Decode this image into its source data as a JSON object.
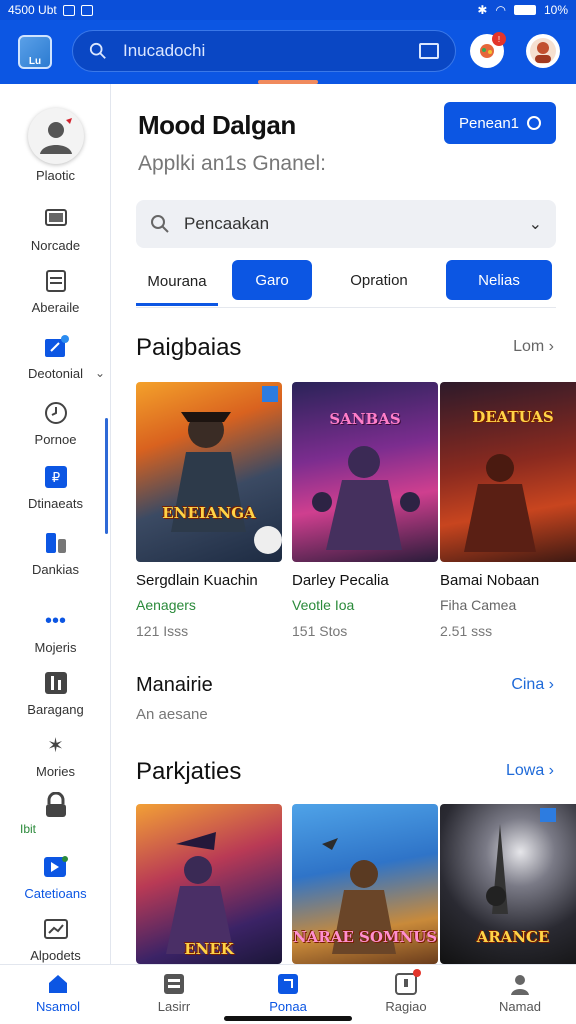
{
  "status_bar": {
    "time": "4500 Ubt",
    "battery": "10%"
  },
  "header": {
    "search_text": "Inucadochi"
  },
  "sidebar": {
    "profile_label": "Plaotic",
    "items": [
      {
        "label": "Norcade"
      },
      {
        "label": "Aberaile"
      },
      {
        "label": "Deotonial"
      },
      {
        "label": "Pornoe"
      },
      {
        "label": "Dtinaeats"
      },
      {
        "label": "Dankias"
      },
      {
        "label": "Mojeris"
      },
      {
        "label": "Baragang"
      },
      {
        "label": "Mories"
      },
      {
        "label": "Ibit"
      },
      {
        "label": "Catetioans"
      },
      {
        "label": "Alpodets"
      }
    ]
  },
  "main": {
    "title": "Mood Dalgan",
    "subtitle": "Applki an1s Gnanel:",
    "primary_button": "Penean1",
    "filter": {
      "value": "Pencaakan"
    },
    "tabs": [
      {
        "label": "Mourana"
      },
      {
        "label": "Garo"
      },
      {
        "label": "Opration"
      },
      {
        "label": "Nelias"
      }
    ],
    "section1": {
      "title": "Paigbaias",
      "link": "Lom",
      "cards": [
        {
          "name": "Sergdlain Kuachin",
          "category": "Aenagers",
          "size": "121 Isss",
          "art_text": "ENEIANGA"
        },
        {
          "name": "Darley Pecalia",
          "category": "Veotle Ioa",
          "size": "151 Stos",
          "art_text": "SANBAS"
        },
        {
          "name": "Bamai Nobaan",
          "category": "Fiha Camea",
          "size": "2.51 sss",
          "art_text": "DEATUAS"
        }
      ]
    },
    "row": {
      "title": "Manairie",
      "subtitle": "An aesane",
      "link": "Cina"
    },
    "section2": {
      "title": "Parkjaties",
      "link": "Lowa",
      "cards": [
        {
          "art_text": "ENEK"
        },
        {
          "art_text": "NARAE SOMNUS"
        },
        {
          "art_text": "ARANCE"
        }
      ]
    }
  },
  "bottom_nav": [
    {
      "label": "Nsamol"
    },
    {
      "label": "Lasirr"
    },
    {
      "label": "Ponaa"
    },
    {
      "label": "Ragiao"
    },
    {
      "label": "Namad"
    }
  ],
  "colors": {
    "brand": "#0c56e3",
    "accent_green": "#2a8a3a",
    "link_blue": "#1f6ad8"
  }
}
